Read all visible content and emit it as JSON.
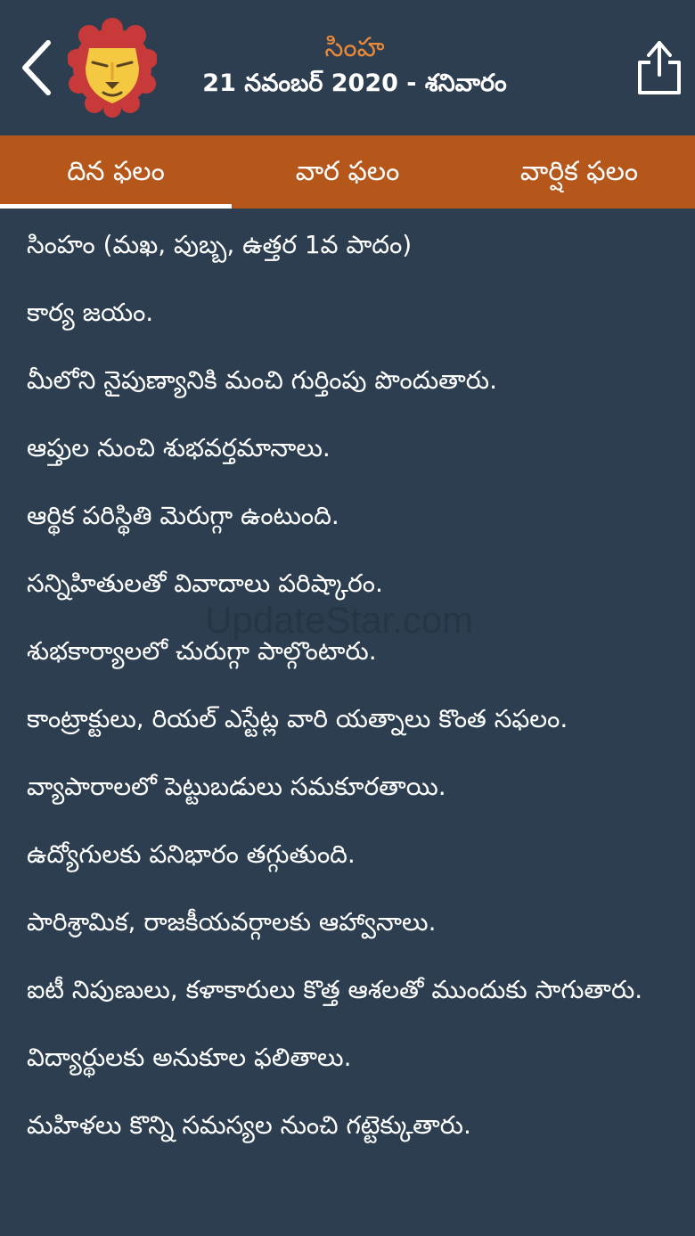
{
  "header": {
    "sign_name": "సింహ",
    "date_line": "21 నవంబర్ 2020 - శనివారం"
  },
  "icons": {
    "back": "chevron-left-icon",
    "avatar": "lion-icon",
    "share": "share-icon"
  },
  "colors": {
    "background": "#2c3e4f",
    "tab_bar": "#b5561b",
    "accent": "#e8893a",
    "lion_mane": "#c83a3a",
    "lion_face": "#f5c842"
  },
  "tabs": [
    {
      "label": "దిన ఫలం",
      "active": true
    },
    {
      "label": "వార ఫలం",
      "active": false
    },
    {
      "label": "వార్షిక ఫలం",
      "active": false
    }
  ],
  "content": {
    "lines": [
      "సింహం (మఖ, పుబ్బ, ఉత్తర 1వ పాదం)",
      "కార్య జయం.",
      "మీలోని నైపుణ్యానికి మంచి గుర్తింపు పొందుతారు.",
      "ఆప్తుల నుంచి శుభవర్తమానాలు.",
      "ఆర్థిక పరిస్థితి మెరుగ్గా ఉంటుంది.",
      "సన్నిహితులతో వివాదాలు పరిష్కారం.",
      "శుభకార్యాలలో చురుగ్గా పాల్గొంటారు.",
      "కాంట్రాక్టులు, రియల్ ఎస్టేట్ల వారి యత్నాలు కొంత సఫలం.",
      "వ్యాపారాలలో పెట్టుబడులు సమకూరతాయి.",
      "ఉద్యోగులకు పనిభారం తగ్గుతుంది.",
      "పారిశ్రామిక, రాజకీయవర్గాలకు ఆహ్వానాలు.",
      "ఐటీ నిపుణులు, కళాకారులు కొత్త ఆశలతో ముందుకు సాగుతారు.",
      "విద్యార్థులకు అనుకూల ఫలితాలు.",
      "మహిళలు కొన్ని సమస్యల నుంచి గట్టెక్కుతారు."
    ]
  },
  "watermark": "UpdateStar.com"
}
